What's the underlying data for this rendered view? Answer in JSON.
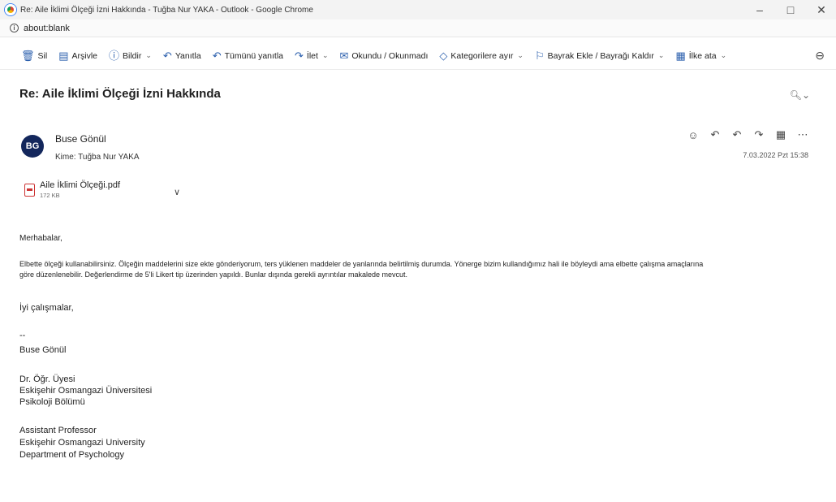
{
  "window": {
    "title": "Re: Aile İklimi Ölçeği İzni Hakkında - Tuğba Nur YAKA - Outlook - Google Chrome",
    "minimize": "–",
    "maximize": "□",
    "close": "✕"
  },
  "address": {
    "url": "about:blank"
  },
  "toolbar": {
    "delete": "Sil",
    "archive": "Arşivle",
    "report": "Bildir",
    "reply": "Yanıtla",
    "reply_all": "Tümünü yanıtla",
    "forward": "İlet",
    "read_unread": "Okundu / Okunmadı",
    "categorize": "Kategorilere ayır",
    "flag": "Bayrak Ekle / Bayrağı Kaldır",
    "pin": "İlke ata"
  },
  "message": {
    "subject": "Re: Aile İklimi Ölçeği İzni Hakkında",
    "avatar_initials": "BG",
    "sender": "Buse Gönül",
    "recipient": "Kime: Tuğba Nur YAKA",
    "date": "7.03.2022 Pzt 15:38",
    "attachment": {
      "name": "Aile İklimi Ölçeği.pdf",
      "size": "172 KB"
    },
    "body": {
      "greeting": "Merhabalar,",
      "line1": "Elbette ölçeği kullanabilirsiniz. Ölçeğin maddelerini size ekte gönderiyorum, ters yüklenen maddeler de yanlarında belirtilmiş durumda. Yönerge bizim kullandığımız hali ile böyleydi ama elbette çalışma amaçlarına",
      "line2": "göre düzenlenebilir. Değerlendirme de 5'li Likert tip üzerinden yapıldı. Bunlar dışında gerekli ayrıntılar makalede mevcut.",
      "closing": "İyi çalışmalar,"
    },
    "signature": {
      "separator": "--",
      "name": "Buse Gönül",
      "title_tr": "Dr. Öğr. Üyesi",
      "univ_tr": "Eskişehir Osmangazi Üniversitesi",
      "dept_tr": "Psikoloji Bölümü",
      "title_en": "Assistant Professor",
      "univ_en": "Eskişehir Osmangazi University",
      "dept_en": "Department of Psychology"
    }
  },
  "colors": {
    "avatar_bg": "#13275c",
    "accent_icon": "#2b5fad"
  }
}
